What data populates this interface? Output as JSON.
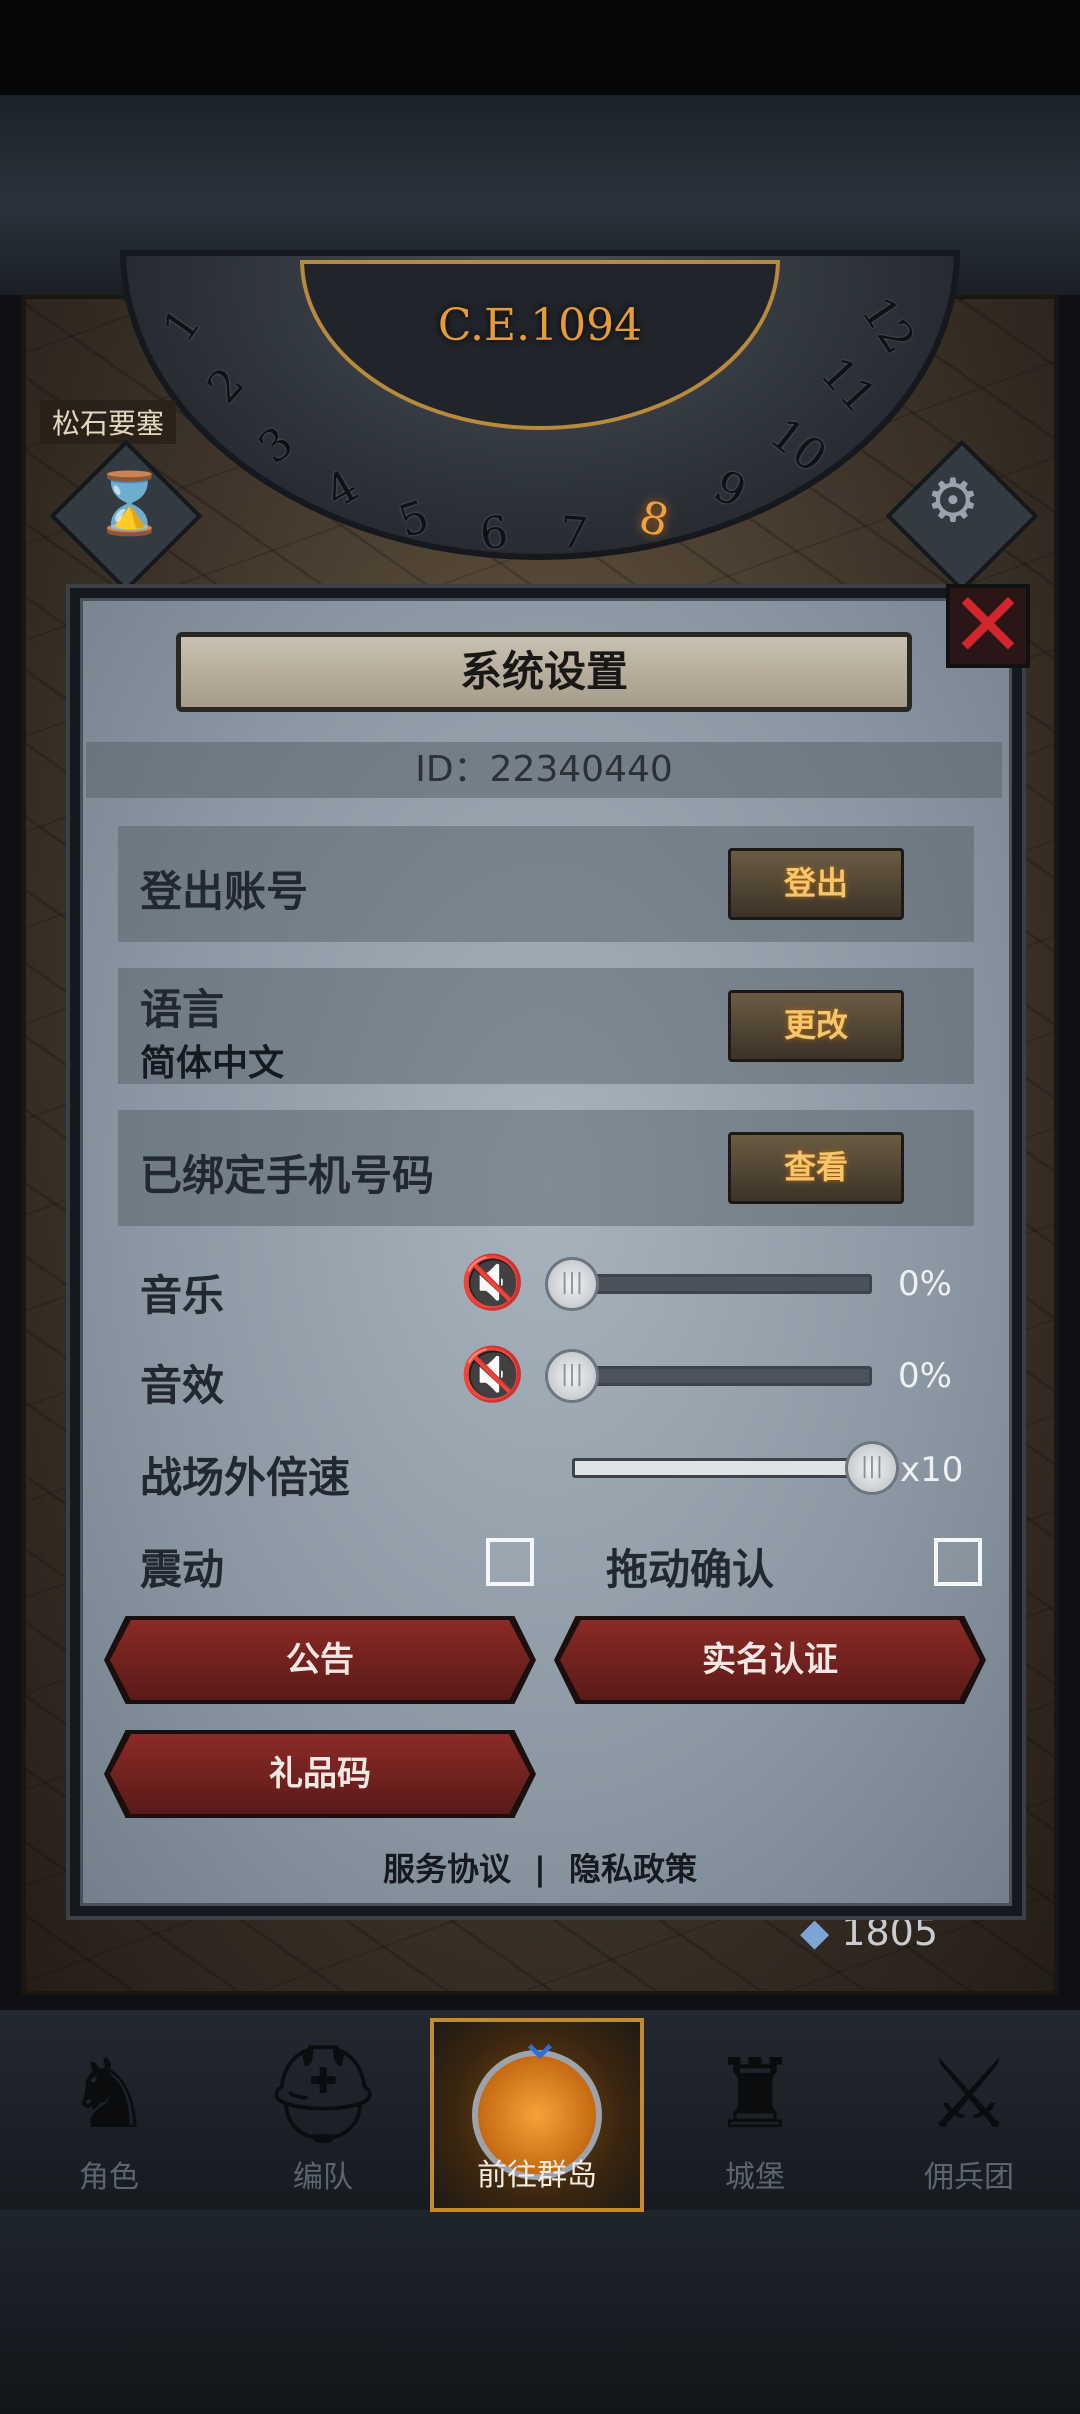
{
  "game": {
    "era": "C.E.1094",
    "dial_numbers": [
      "1",
      "2",
      "3",
      "4",
      "5",
      "6",
      "7",
      "8",
      "9",
      "10",
      "11",
      "12"
    ],
    "active_hour": "8",
    "location": "松石要塞",
    "currency_value": "1805"
  },
  "dialog": {
    "title": "系统设置",
    "id_text": "ID：22340440",
    "logout": {
      "label": "登出账号",
      "button": "登出"
    },
    "language": {
      "label": "语言",
      "value": "简体中文",
      "button": "更改"
    },
    "phone": {
      "label": "已绑定手机号码",
      "button": "查看"
    },
    "music": {
      "label": "音乐",
      "percent": "0%",
      "level": 0
    },
    "sfx": {
      "label": "音效",
      "percent": "0%",
      "level": 0
    },
    "speed": {
      "label": "战场外倍速",
      "value": "x10",
      "level": 1.0
    },
    "vibration": {
      "label": "震动",
      "checked": false
    },
    "drag_confirm": {
      "label": "拖动确认",
      "checked": false
    },
    "buttons": {
      "notice": "公告",
      "real_name": "实名认证",
      "gift_code": "礼品码"
    },
    "footer": {
      "service": "服务协议",
      "separator": "|",
      "privacy": "隐私政策"
    }
  },
  "nav": {
    "items": [
      {
        "label": "角色",
        "icon": "knight-icon"
      },
      {
        "label": "编队",
        "icon": "helmet-icon"
      },
      {
        "label": "前往群岛",
        "icon": "island-compass-icon"
      },
      {
        "label": "城堡",
        "icon": "castle-icon"
      },
      {
        "label": "佣兵团",
        "icon": "mercenary-icon"
      }
    ],
    "active_index": 2
  },
  "colors": {
    "accent_gold": "#f7c56a",
    "close_red": "#d3262c",
    "active_frame": "#c58a2b"
  }
}
